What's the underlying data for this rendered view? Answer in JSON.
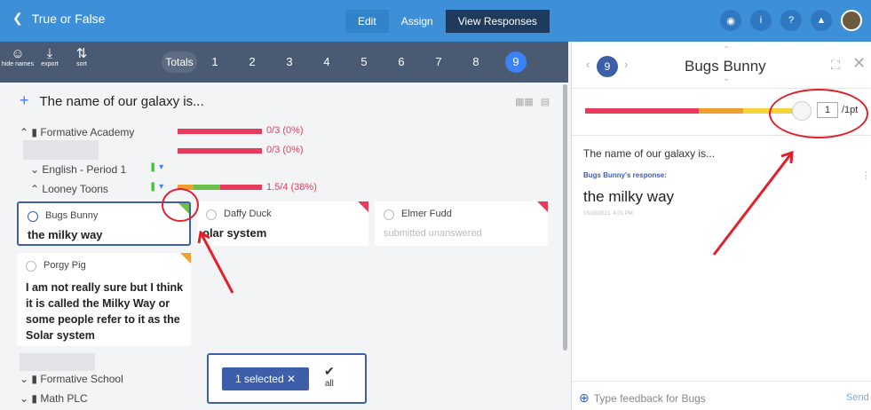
{
  "topbar": {
    "back_label": "True or False",
    "tabs": [
      "Edit",
      "Assign",
      "View Responses"
    ]
  },
  "toolbar": {
    "hide_names": "hide names",
    "export": "export",
    "sort": "sort",
    "totals": "Totals",
    "questions": [
      "1",
      "2",
      "3",
      "4",
      "5",
      "6",
      "7",
      "8",
      "9"
    ]
  },
  "question": {
    "title": "The name of our galaxy is..."
  },
  "groups": {
    "academy": {
      "label": "Formative Academy",
      "score1": "0/3 (0%)",
      "score2": "0/3 (0%)"
    },
    "english": {
      "label": "English - Period 1"
    },
    "looney": {
      "label": "Looney Toons",
      "score": "1.5/4 (38%)"
    },
    "school": {
      "label": "Formative School"
    },
    "math": {
      "label": "Math PLC"
    }
  },
  "students": [
    {
      "name": "Bugs Bunny",
      "answer": "the milky way"
    },
    {
      "name": "Daffy Duck",
      "answer": "olar system"
    },
    {
      "name": "Elmer Fudd",
      "answer": "submitted unanswered"
    },
    {
      "name": "Porgy Pig",
      "answer": "I am not really sure but I think it is called the Milky Way or some people refer to it as the Solar system"
    }
  ],
  "selection": {
    "label": "1 selected ✕",
    "all": "all"
  },
  "panel": {
    "index": "9",
    "student": "Bugs Bunny",
    "score_value": "1",
    "score_max": "/1pt",
    "question": "The name of our galaxy is...",
    "response_label": "Bugs Bunny's response:",
    "answer": "the milky way",
    "timestamp": "03/18/2021, 4:01 PM",
    "feedback_placeholder": "Type feedback for Bugs",
    "send": "Send"
  },
  "colors": {
    "accent": "#3d8fd8",
    "red": "#e83a5c",
    "orange": "#f0a030",
    "green": "#6cc04a"
  }
}
